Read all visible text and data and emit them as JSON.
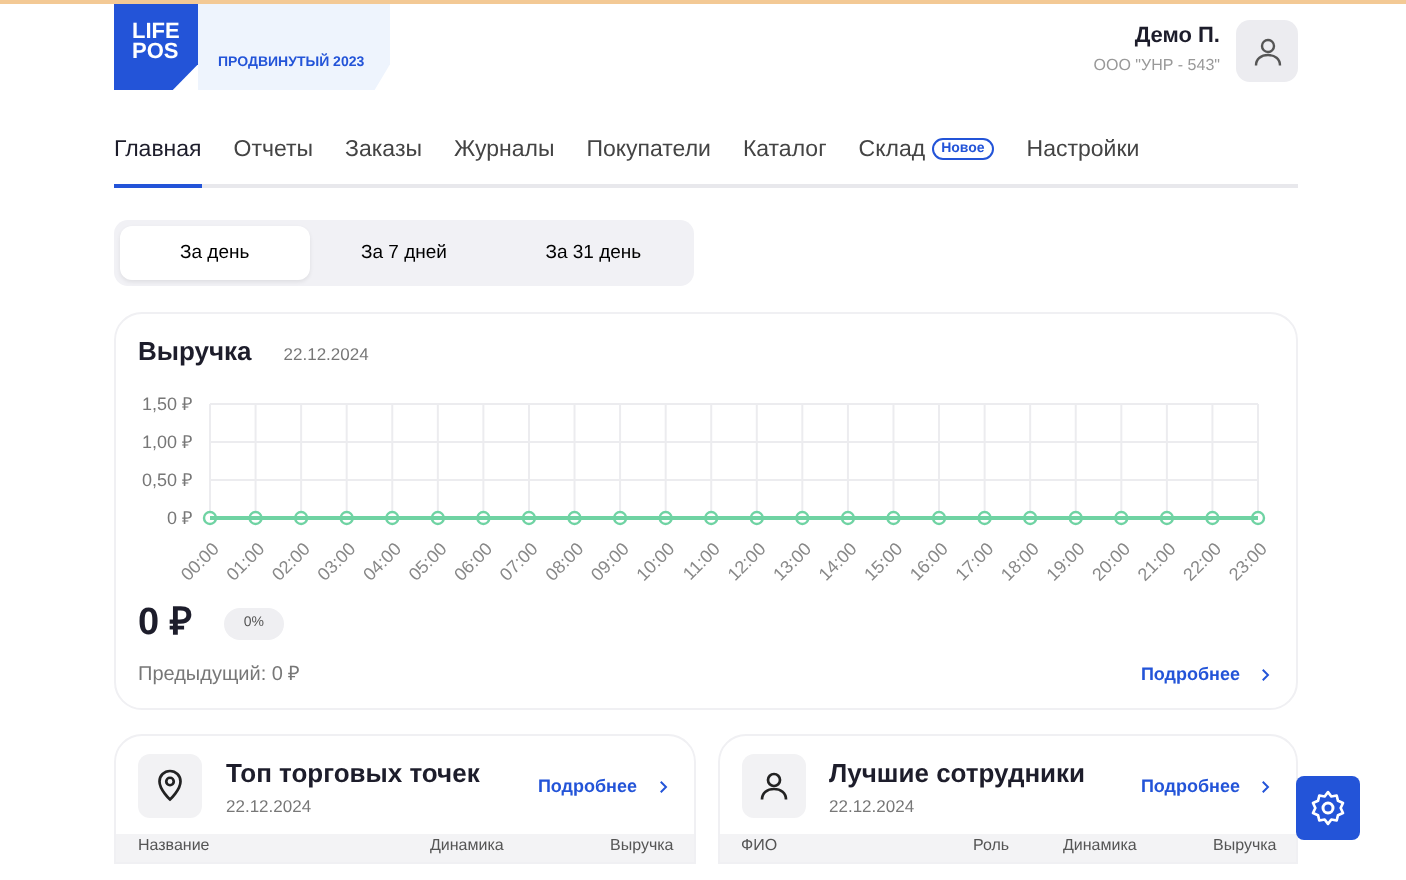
{
  "header": {
    "logo": [
      "LIFE",
      "POS"
    ],
    "plan": "ПРОДВИНУТЫЙ 2023",
    "user_name": "Демо П.",
    "company": "ООО \"УНР - 543\""
  },
  "nav": [
    {
      "label": "Главная",
      "selected": true
    },
    {
      "label": "Отчеты",
      "selected": false
    },
    {
      "label": "Заказы",
      "selected": false
    },
    {
      "label": "Журналы",
      "selected": false
    },
    {
      "label": "Покупатели",
      "selected": false
    },
    {
      "label": "Каталог",
      "selected": false
    },
    {
      "label": "Склад",
      "selected": false,
      "badge": "Новое"
    },
    {
      "label": "Настройки",
      "selected": false
    }
  ],
  "periods": [
    {
      "label": "За день",
      "selected": true
    },
    {
      "label": "За 7 дней",
      "selected": false
    },
    {
      "label": "За 31 день",
      "selected": false
    }
  ],
  "revenue": {
    "title": "Выручка",
    "date": "22.12.2024",
    "chart_data": {
      "type": "line",
      "categories": [
        "00:00",
        "01:00",
        "02:00",
        "03:00",
        "04:00",
        "05:00",
        "06:00",
        "07:00",
        "08:00",
        "09:00",
        "10:00",
        "11:00",
        "12:00",
        "13:00",
        "14:00",
        "15:00",
        "16:00",
        "17:00",
        "18:00",
        "19:00",
        "20:00",
        "21:00",
        "22:00",
        "23:00"
      ],
      "values": [
        0,
        0,
        0,
        0,
        0,
        0,
        0,
        0,
        0,
        0,
        0,
        0,
        0,
        0,
        0,
        0,
        0,
        0,
        0,
        0,
        0,
        0,
        0,
        0
      ],
      "ylim": [
        0,
        1.5
      ],
      "grid": true,
      "marker": "circle",
      "yticks": [
        {
          "value": 0,
          "label": "0 ₽"
        },
        {
          "value": 0.5,
          "label": "0,50 ₽"
        },
        {
          "value": 1,
          "label": "1,00 ₽"
        },
        {
          "value": 1.5,
          "label": "1,50 ₽"
        }
      ]
    },
    "total": "0 ₽",
    "change": "0%",
    "previous": "Предыдущий: 0 ₽",
    "more": "Подробнее"
  },
  "widgets": [
    {
      "kind": "pin",
      "title": "Топ торговых точек",
      "date": "22.12.2024",
      "more": "Подробнее",
      "columns": [
        "Название",
        "Динамика",
        "Выручка"
      ]
    },
    {
      "kind": "person",
      "title": "Лучшие сотрудники",
      "date": "22.12.2024",
      "more": "Подробнее",
      "columns": [
        "ФИО",
        "Роль",
        "Динамика",
        "Выручка"
      ]
    }
  ]
}
